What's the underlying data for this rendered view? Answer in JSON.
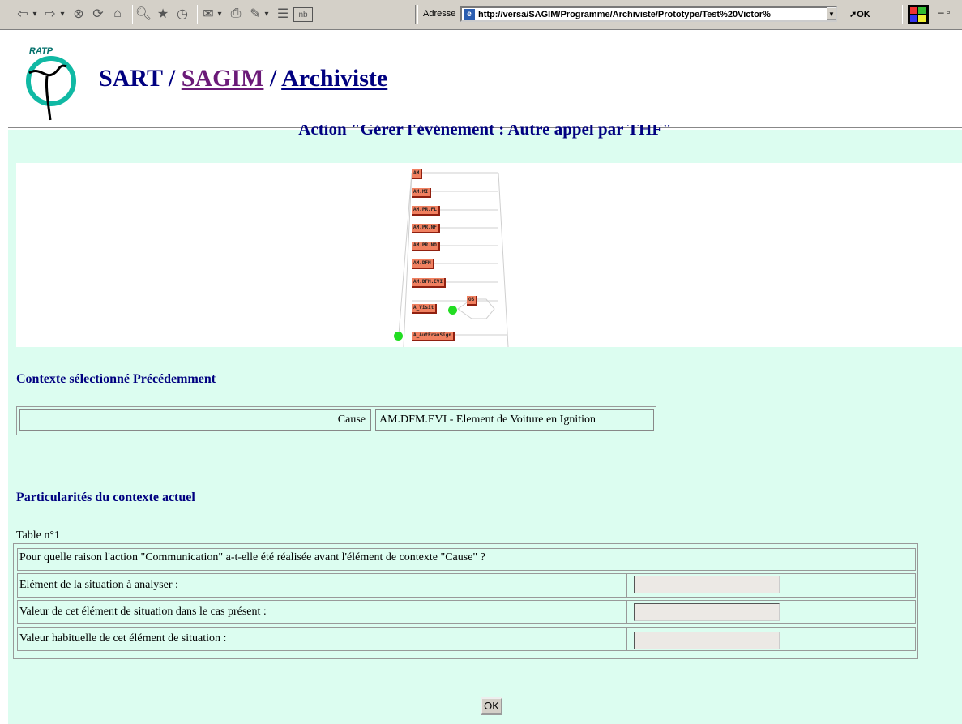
{
  "toolbar": {
    "address_label": "Adresse",
    "url": "http://versa/SAGIM/Programme/Archiviste/Prototype/Test%20Victor%",
    "go_label": "OK",
    "icons": [
      "back-icon",
      "forward-icon",
      "stop-icon",
      "refresh-icon",
      "home-icon",
      "search-icon",
      "favorites-icon",
      "history-icon",
      "mail-icon",
      "print-icon",
      "edit-icon",
      "discuss-icon",
      "notebook-icon"
    ]
  },
  "header": {
    "logo_text": "RATP",
    "title_prefix": "SART / ",
    "title_link1": "SAGIM",
    "title_sep": " / ",
    "title_link2": "Archiviste"
  },
  "action_title": "Action \"Gérer l'événement : Autre appel par THF\"",
  "diagram": {
    "nodes": [
      "AM",
      "AM.MI",
      "AM.PR.FL",
      "AM.PR.NF",
      "AM.PR.NO",
      "AM.DFM",
      "AM.DFM.EVI",
      "A_Visit",
      "OS",
      "A_AutFranSign"
    ]
  },
  "context_prev": {
    "heading": "Contexte sélectionné Précédemment",
    "label": "Cause",
    "value": "AM.DFM.EVI - Element de Voiture en Ignition"
  },
  "context_current": {
    "heading": "Particularités du contexte actuel",
    "table_label": "Table n°1",
    "question": "Pour quelle raison l'action \"Communication\" a-t-elle été réalisée avant l'élément de contexte  \"Cause\" ?",
    "rows": [
      {
        "label": "Elément de la situation à analyser :",
        "value": ""
      },
      {
        "label": "Valeur de cet élément de situation dans le cas présent :",
        "value": ""
      },
      {
        "label": "Valeur habituelle de cet élément de situation :",
        "value": ""
      }
    ]
  },
  "submit_label": "OK",
  "colors": {
    "page_bg": "#dcfdf0",
    "title": "#000080",
    "visited_link": "#6b1a78",
    "node": "#f08060"
  }
}
